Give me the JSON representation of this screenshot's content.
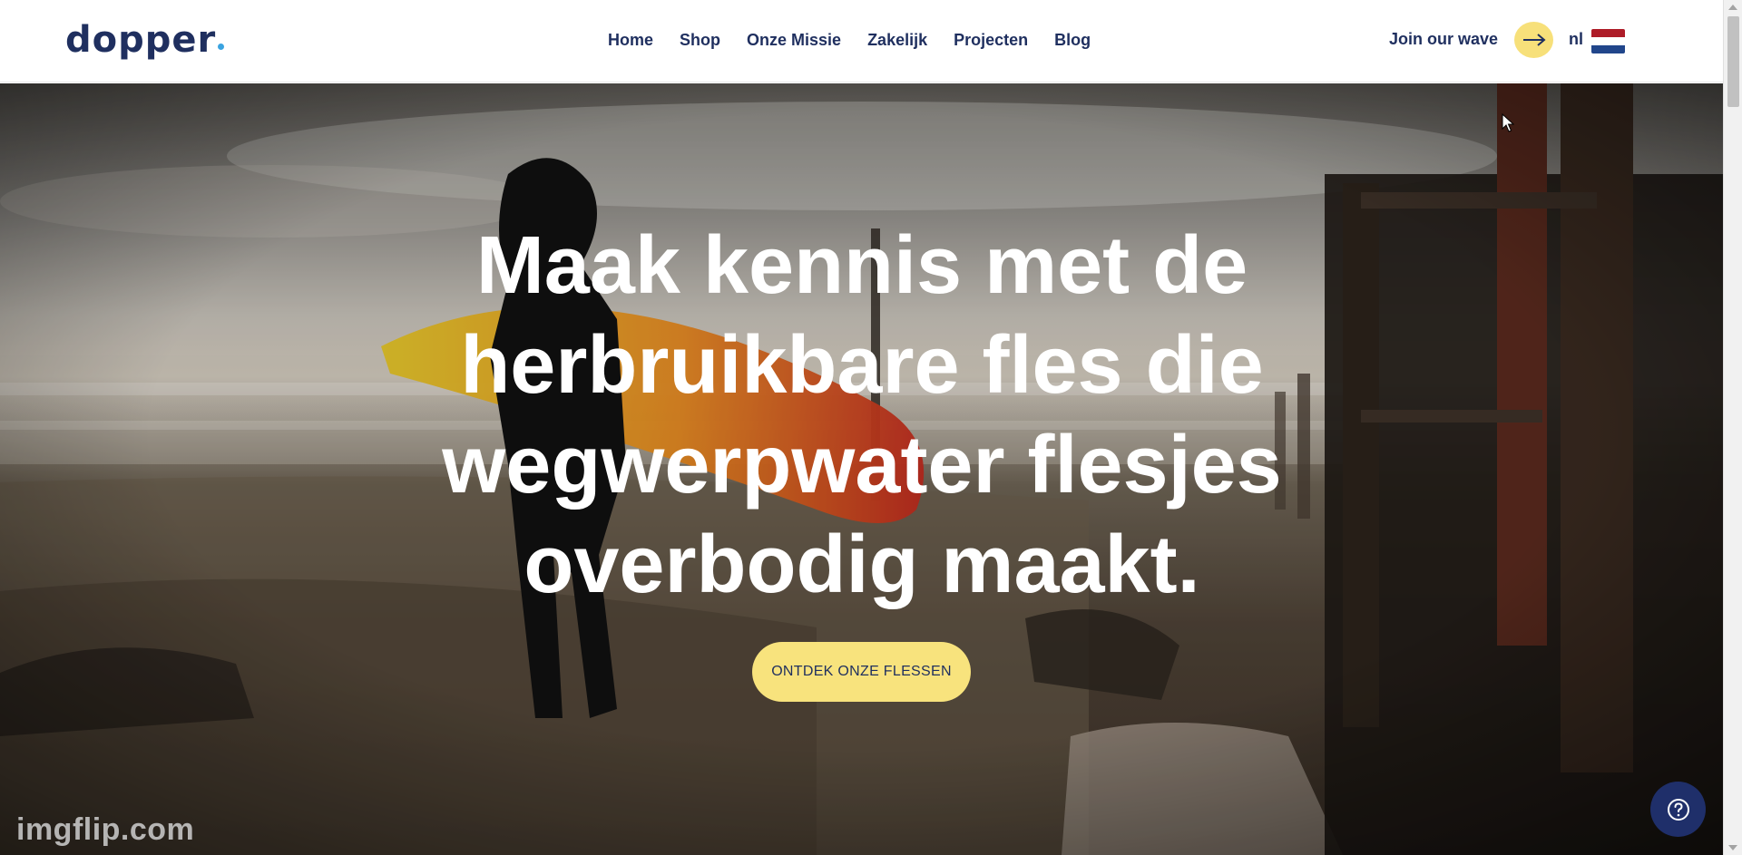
{
  "header": {
    "logo_text": "dopper",
    "nav": [
      "Home",
      "Shop",
      "Onze Missie",
      "Zakelijk",
      "Projecten",
      "Blog"
    ],
    "join_label": "Join our wave",
    "join_icon": "arrow-right-icon",
    "lang_label": "nl",
    "flag_icon": "netherlands-flag-icon"
  },
  "hero": {
    "title": "Maak kennis met de herbruikbare fles die wegwerpwater flesjes overbodig maakt.",
    "cta_label": "ONTDEK ONZE FLESSEN",
    "watermark": "imgflip.com"
  },
  "help": {
    "icon": "question-mark-icon"
  },
  "colors": {
    "brand_navy": "#1f2f5f",
    "accent_yellow": "#f8e37d",
    "help_button": "#1f2f6a"
  }
}
